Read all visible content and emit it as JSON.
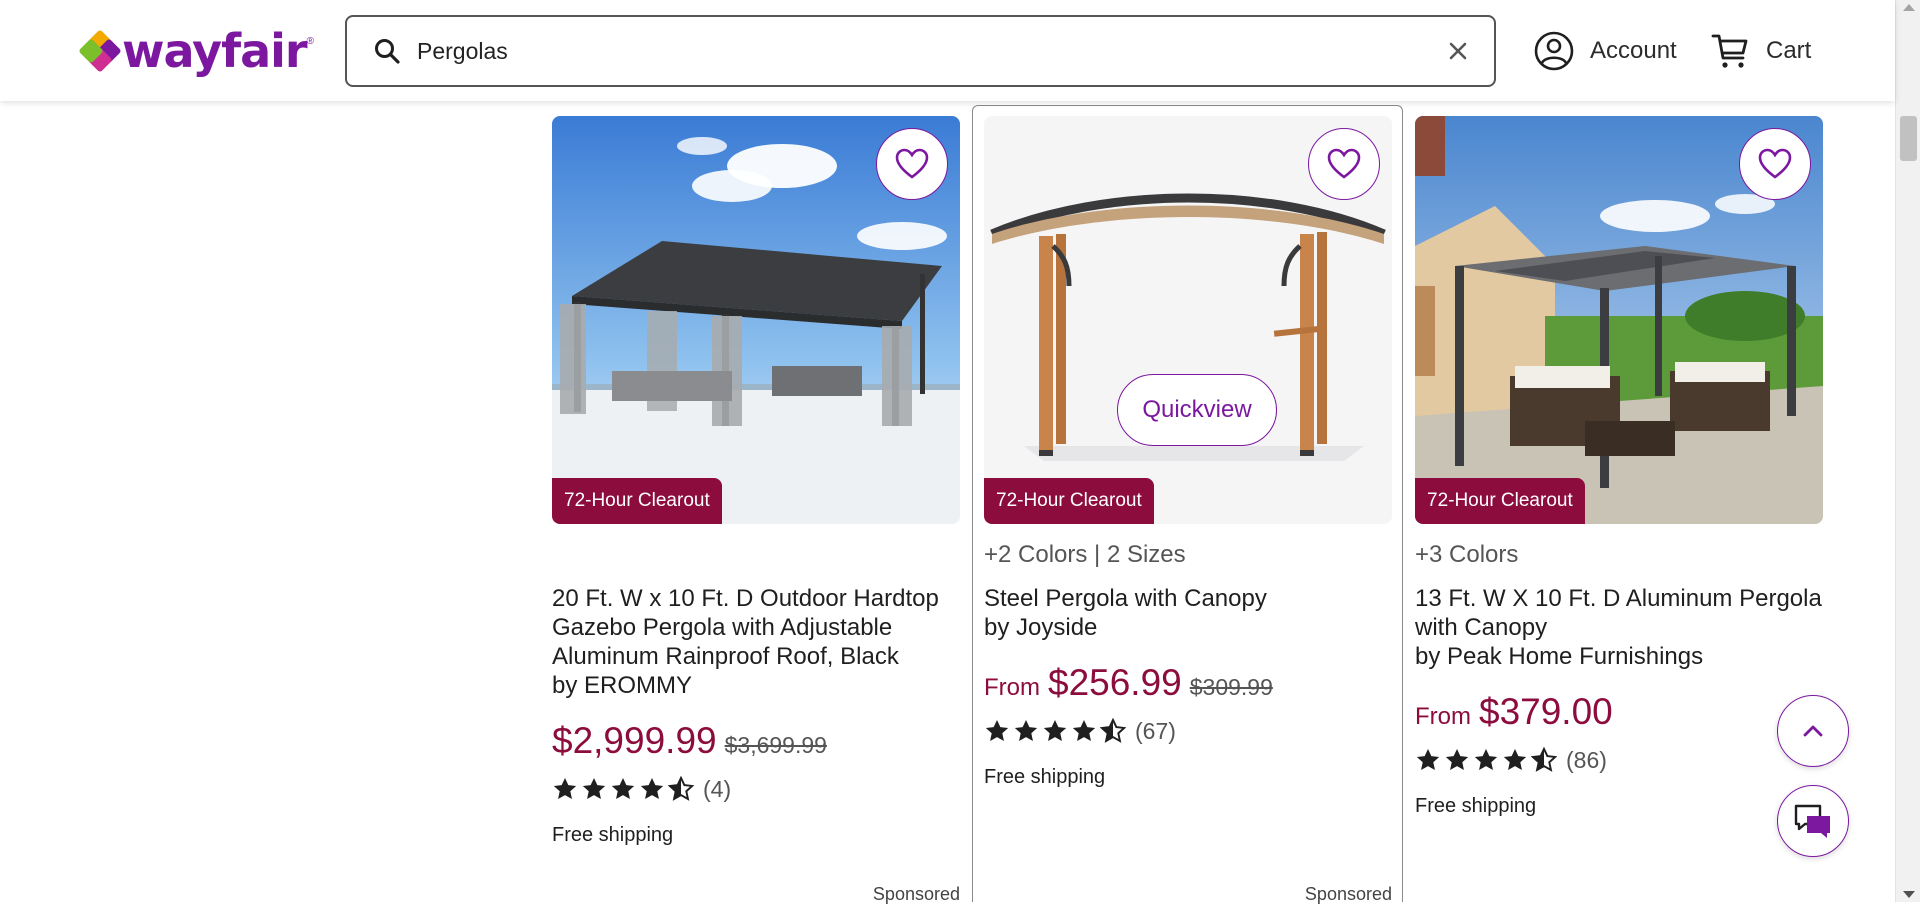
{
  "brand": {
    "logo_text": "wayfair",
    "tm": "®",
    "color": "#7b189f"
  },
  "search": {
    "value": "Pergolas",
    "placeholder": ""
  },
  "header": {
    "account_label": "Account",
    "cart_label": "Cart"
  },
  "products": [
    {
      "badge": "72-Hour Clearout",
      "variants": "",
      "title_lines": [
        "20 Ft. W x 10 Ft. D Outdoor Hardtop",
        "Gazebo Pergola with Adjustable",
        "Aluminum Rainproof Roof, Black"
      ],
      "by": "by EROMMY",
      "price_from": "",
      "price": "$2,999.99",
      "price_old": "$3,699.99",
      "rating": 4.5,
      "rating_count": "(4)",
      "shipping": "Free shipping",
      "sponsored": "Sponsored"
    },
    {
      "badge": "72-Hour Clearout",
      "variants": "+2 Colors | 2 Sizes",
      "title_lines": [
        "Steel Pergola with Canopy"
      ],
      "by": "by Joyside",
      "price_from": "From",
      "price": "$256.99",
      "price_old": "$309.99",
      "rating": 4.5,
      "rating_count": "(67)",
      "shipping": "Free shipping",
      "sponsored": "Sponsored",
      "quickview": "Quickview"
    },
    {
      "badge": "72-Hour Clearout",
      "variants": "+3 Colors",
      "title_lines": [
        "13 Ft. W X 10 Ft. D Aluminum Pergola",
        "with Canopy"
      ],
      "by": "by Peak Home Furnishings",
      "price_from": "From",
      "price": "$379.00",
      "price_old": "",
      "rating": 4.5,
      "rating_count": "(86)",
      "shipping": "Free shipping",
      "sponsored": ""
    }
  ],
  "colors": {
    "accent": "#7b189f",
    "price": "#8c0d3d",
    "badge": "#8c0d3d"
  },
  "icons": {
    "search": "search-icon",
    "clear": "close-icon",
    "account": "account-icon",
    "cart": "cart-icon",
    "favorite": "heart-icon",
    "back_to_top": "chevron-up-icon",
    "chat": "chat-icon"
  }
}
